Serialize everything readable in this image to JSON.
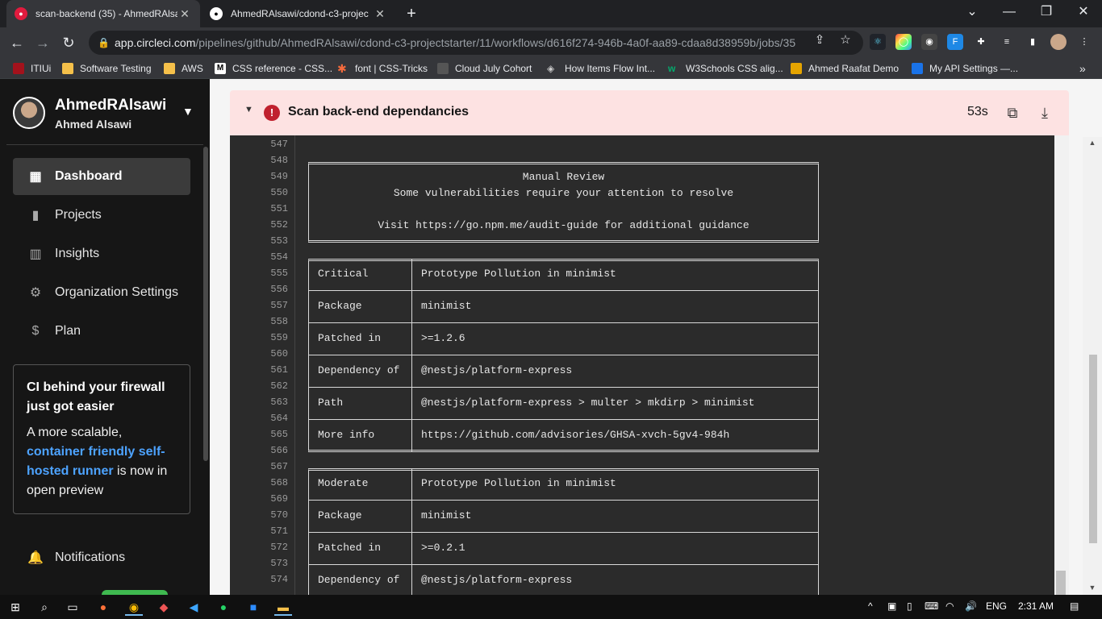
{
  "browser": {
    "tabs": [
      {
        "title": "scan-backend (35) - AhmedRAlsa",
        "active": true
      },
      {
        "title": "AhmedRAlsawi/cdond-c3-projec",
        "active": false
      }
    ],
    "url_host": "app.circleci.com",
    "url_path": "/pipelines/github/AhmedRAlsawi/cdond-c3-projectstarter/11/workflows/d616f274-946b-4a0f-aa89-cdaa8d38959b/jobs/35",
    "bookmarks": [
      "ITIUi",
      "Software Testing",
      "AWS",
      "CSS reference - CSS...",
      "font | CSS-Tricks",
      "Cloud July Cohort",
      "How Items Flow Int...",
      "W3Schools CSS alig...",
      "Ahmed Raafat Demo",
      "My API Settings —..."
    ]
  },
  "sidebar": {
    "org_name": "AhmedRAlsawi",
    "user_name": "Ahmed Alsawi",
    "items": [
      {
        "label": "Dashboard",
        "icon": "dashboard-icon",
        "active": true
      },
      {
        "label": "Projects",
        "icon": "projects-icon",
        "active": false
      },
      {
        "label": "Insights",
        "icon": "insights-icon",
        "active": false
      },
      {
        "label": "Organization Settings",
        "icon": "gear-icon",
        "active": false
      },
      {
        "label": "Plan",
        "icon": "plan-icon",
        "active": false
      }
    ],
    "promo": {
      "title": "CI behind your firewall just got easier",
      "body_pre": "A more scalable,",
      "link": "container friendly self-hosted runner",
      "body_post": "is now in open preview"
    },
    "notifications_label": "Notifications"
  },
  "step": {
    "title": "Scan back-end dependancies",
    "duration": "53s",
    "status_color": "#c0212e"
  },
  "console": {
    "line_numbers": [
      "547",
      "548",
      "549",
      "550",
      "551",
      "552",
      "553",
      "554",
      "555",
      "556",
      "557",
      "558",
      "559",
      "560",
      "561",
      "562",
      "563",
      "564",
      "565",
      "566",
      "567",
      "568",
      "569",
      "570",
      "571",
      "572",
      "573",
      "574"
    ],
    "review_box": {
      "line1": "Manual Review",
      "line2": "Some vulnerabilities require your attention to resolve",
      "line3": "Visit https://go.npm.me/audit-guide for additional guidance"
    },
    "vuln1": [
      {
        "key": "Critical",
        "value": "Prototype Pollution in minimist"
      },
      {
        "key": "Package",
        "value": "minimist"
      },
      {
        "key": "Patched in",
        "value": ">=1.2.6"
      },
      {
        "key": "Dependency of",
        "value": "@nestjs/platform-express"
      },
      {
        "key": "Path",
        "value": "@nestjs/platform-express > multer > mkdirp > minimist"
      },
      {
        "key": "More info",
        "value": "https://github.com/advisories/GHSA-xvch-5gv4-984h"
      }
    ],
    "vuln2": [
      {
        "key": "Moderate",
        "value": "Prototype Pollution in minimist"
      },
      {
        "key": "Package",
        "value": "minimist"
      },
      {
        "key": "Patched in",
        "value": ">=0.2.1"
      },
      {
        "key": "Dependency of",
        "value": "@nestjs/platform-express"
      }
    ]
  },
  "taskbar": {
    "language": "ENG",
    "time": "2:31 AM"
  }
}
